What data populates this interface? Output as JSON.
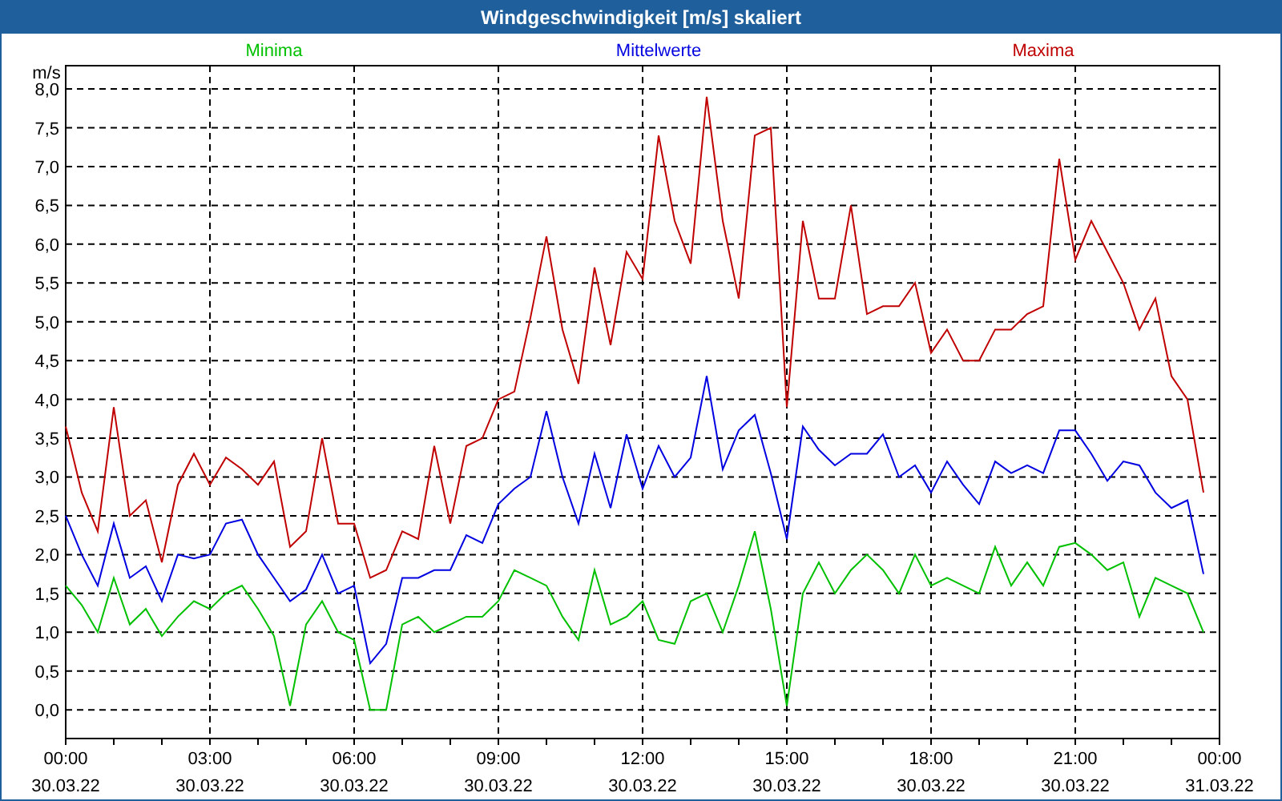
{
  "window": {
    "title": "Windgeschwindigkeit [m/s] skaliert"
  },
  "chart": {
    "chart_data": {
      "type": "line",
      "ylabel": "m/s",
      "categories": [
        "00:00 30.03.22",
        null,
        null,
        null,
        null,
        null,
        null,
        null,
        null,
        "03:00 30.03.22",
        null,
        null,
        null,
        null,
        null,
        null,
        null,
        null,
        "06:00 30.03.22",
        null,
        null,
        null,
        null,
        null,
        null,
        null,
        null,
        "09:00 30.03.22",
        null,
        null,
        null,
        null,
        null,
        null,
        null,
        null,
        "12:00 30.03.22",
        null,
        null,
        null,
        null,
        null,
        null,
        null,
        null,
        "15:00 30.03.22",
        null,
        null,
        null,
        null,
        null,
        null,
        null,
        null,
        "18:00 30.03.22",
        null,
        null,
        null,
        null,
        null,
        null,
        null,
        null,
        "21:00 30.03.22",
        null,
        null,
        null,
        null,
        null,
        null,
        null,
        null,
        "00:00 31.03.22"
      ],
      "series": [
        {
          "name": "Minima",
          "color": "#00c000",
          "values": [
            1.6,
            1.35,
            1.0,
            1.7,
            1.1,
            1.3,
            0.95,
            1.2,
            1.4,
            1.3,
            1.5,
            1.6,
            1.3,
            0.95,
            0.05,
            1.1,
            1.4,
            1.0,
            0.9,
            0,
            0,
            1.1,
            1.2,
            1.0,
            1.1,
            1.2,
            1.2,
            1.4,
            1.8,
            1.7,
            1.6,
            1.2,
            0.9,
            1.8,
            1.1,
            1.2,
            1.4,
            0.9,
            0.85,
            1.4,
            1.5,
            1.0,
            1.6,
            2.3,
            1.3,
            0.05,
            1.5,
            1.9,
            1.5,
            1.8,
            2.0,
            1.8,
            1.5,
            2.0,
            1.6,
            1.7,
            1.6,
            1.5,
            2.1,
            1.6,
            1.9,
            1.6,
            2.1,
            2.15,
            2.0,
            1.8,
            1.9,
            1.2,
            1.7,
            1.6,
            1.5,
            1.0,
            null
          ]
        },
        {
          "name": "Mittelwerte",
          "color": "#0000e0",
          "values": [
            2.5,
            2.0,
            1.6,
            2.4,
            1.7,
            1.85,
            1.4,
            2.0,
            1.95,
            2.0,
            2.4,
            2.45,
            2.0,
            1.7,
            1.4,
            1.55,
            2.0,
            1.5,
            1.6,
            0.6,
            0.85,
            1.7,
            1.7,
            1.8,
            1.8,
            2.25,
            2.15,
            2.65,
            2.85,
            3.0,
            3.85,
            3.0,
            2.4,
            3.3,
            2.6,
            3.55,
            2.85,
            3.4,
            3.0,
            3.25,
            4.3,
            3.1,
            3.6,
            3.8,
            3.05,
            2.2,
            3.65,
            3.35,
            3.15,
            3.3,
            3.3,
            3.55,
            3.0,
            3.15,
            2.8,
            3.2,
            2.9,
            2.65,
            3.2,
            3.05,
            3.15,
            3.05,
            3.6,
            3.6,
            3.3,
            2.95,
            3.2,
            3.15,
            2.8,
            2.6,
            2.7,
            1.75,
            null
          ]
        },
        {
          "name": "Maxima",
          "color": "#c00000",
          "values": [
            3.65,
            2.8,
            2.3,
            3.9,
            2.5,
            2.7,
            1.9,
            2.9,
            3.3,
            2.9,
            3.25,
            3.1,
            2.9,
            3.2,
            2.1,
            2.3,
            3.5,
            2.4,
            2.4,
            1.7,
            1.8,
            2.3,
            2.2,
            3.4,
            2.4,
            3.4,
            3.5,
            4.0,
            4.1,
            5.05,
            6.1,
            4.9,
            4.2,
            5.7,
            4.7,
            5.9,
            5.55,
            7.4,
            6.3,
            5.75,
            7.9,
            6.3,
            5.3,
            7.4,
            7.5,
            3.9,
            6.3,
            5.3,
            5.3,
            6.5,
            5.1,
            5.2,
            5.2,
            5.5,
            4.6,
            4.9,
            4.5,
            4.5,
            4.9,
            4.9,
            5.1,
            5.2,
            7.1,
            5.8,
            6.3,
            5.9,
            5.5,
            4.9,
            5.3,
            4.3,
            4.0,
            2.8,
            null
          ]
        }
      ],
      "ylim": [
        -0.37,
        8.3
      ],
      "grid": true,
      "yticks": [
        {
          "value": 0,
          "label": "0,0"
        },
        {
          "value": 0.5,
          "label": "0,5"
        },
        {
          "value": 1,
          "label": "1,0"
        },
        {
          "value": 1.5,
          "label": "1,5"
        },
        {
          "value": 2,
          "label": "2,0"
        },
        {
          "value": 2.5,
          "label": "2,5"
        },
        {
          "value": 3,
          "label": "3,0"
        },
        {
          "value": 3.5,
          "label": "3,5"
        },
        {
          "value": 4,
          "label": "4,0"
        },
        {
          "value": 4.5,
          "label": "4,5"
        },
        {
          "value": 5,
          "label": "5,0"
        },
        {
          "value": 5.5,
          "label": "5,5"
        },
        {
          "value": 6,
          "label": "6,0"
        },
        {
          "value": 6.5,
          "label": "6,5"
        },
        {
          "value": 7,
          "label": "7,0"
        },
        {
          "value": 7.5,
          "label": "7,5"
        },
        {
          "value": 8,
          "label": "8,0"
        }
      ]
    }
  }
}
